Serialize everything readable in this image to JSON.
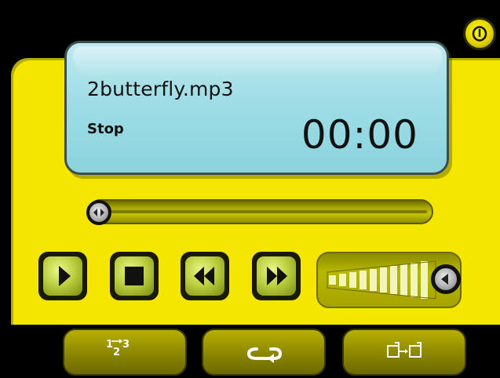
{
  "display": {
    "track_name": "2butterfly.mp3",
    "status": "Stop",
    "time": "00:00"
  },
  "progress": {
    "fraction": 0.0
  },
  "volume": {
    "fraction": 1.0
  },
  "controls": {
    "play_icon": "play-icon",
    "stop_icon": "stop-icon",
    "rewind_icon": "rewind-icon",
    "fast_forward_icon": "fast-forward-icon",
    "power_icon": "power-icon"
  },
  "bottom_bar": {
    "shuffle_label": "1→3\n2",
    "repeat_icon": "repeat-icon",
    "mode_icon": "switch-view-icon"
  },
  "colors": {
    "panel": "#f5e600",
    "lcd": "#9fdde6",
    "button": "#bcd040"
  }
}
